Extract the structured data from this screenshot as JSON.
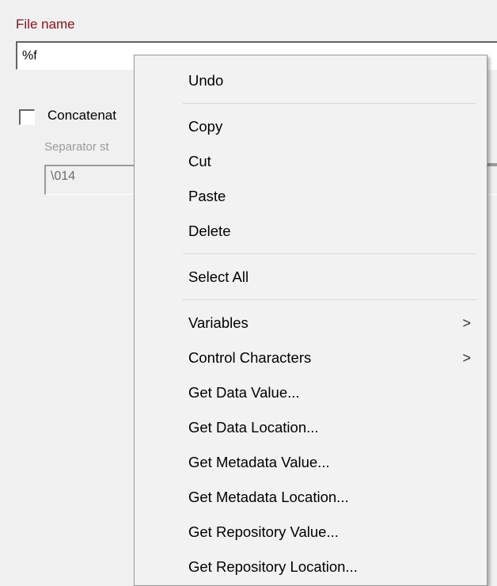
{
  "form": {
    "file_name_label": "File name",
    "file_name_value": "%f",
    "concatenate_label": "Concatenat",
    "separator_label": "Separator st",
    "separator_value": "\\014"
  },
  "context_menu": {
    "undo": "Undo",
    "copy": "Copy",
    "cut": "Cut",
    "paste": "Paste",
    "delete": "Delete",
    "select_all": "Select All",
    "variables": "Variables",
    "control_characters": "Control Characters",
    "get_data_value": "Get Data Value...",
    "get_data_location": "Get Data Location...",
    "get_metadata_value": "Get Metadata Value...",
    "get_metadata_location": "Get Metadata Location...",
    "get_repository_value": "Get Repository Value...",
    "get_repository_location": "Get Repository Location...",
    "submenu_arrow": ">"
  },
  "icons": {
    "submenu_arrow_icon": "chevron-right-icon"
  },
  "colors": {
    "label_red": "#8b1010",
    "menu_background": "#f2f2f2",
    "dialog_background": "#f0f0f0",
    "disabled_text": "#9a9a9a"
  }
}
